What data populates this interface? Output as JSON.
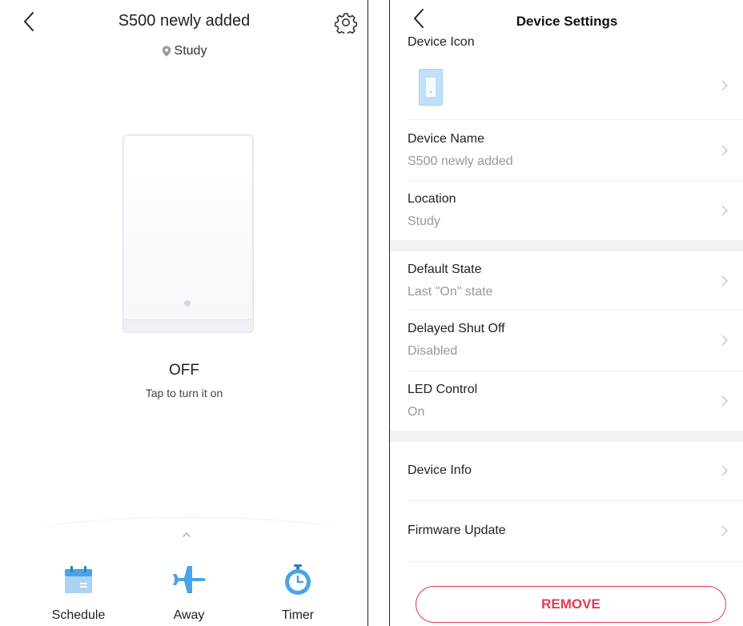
{
  "left": {
    "title": "S500 newly added",
    "location": "Study",
    "state": "OFF",
    "hint": "Tap to turn it on",
    "actions": [
      {
        "label": "Schedule",
        "icon": "calendar-icon"
      },
      {
        "label": "Away",
        "icon": "airplane-icon"
      },
      {
        "label": "Timer",
        "icon": "stopwatch-icon"
      }
    ]
  },
  "right": {
    "title": "Device Settings",
    "icon_label": "Device Icon",
    "rows": [
      {
        "title": "Device Name",
        "value": "S500 newly added"
      },
      {
        "title": "Location",
        "value": "Study"
      },
      {
        "title": "Default State",
        "value": "Last \"On\" state"
      },
      {
        "title": "Delayed Shut Off",
        "value": "Disabled"
      },
      {
        "title": "LED Control",
        "value": "On"
      },
      {
        "title": "Device Info"
      },
      {
        "title": "Firmware Update"
      }
    ],
    "remove_label": "REMOVE"
  },
  "colors": {
    "accent_blue": "#4aa3e6",
    "danger": "#e33b55",
    "section_gray": "#f2f2f2"
  }
}
